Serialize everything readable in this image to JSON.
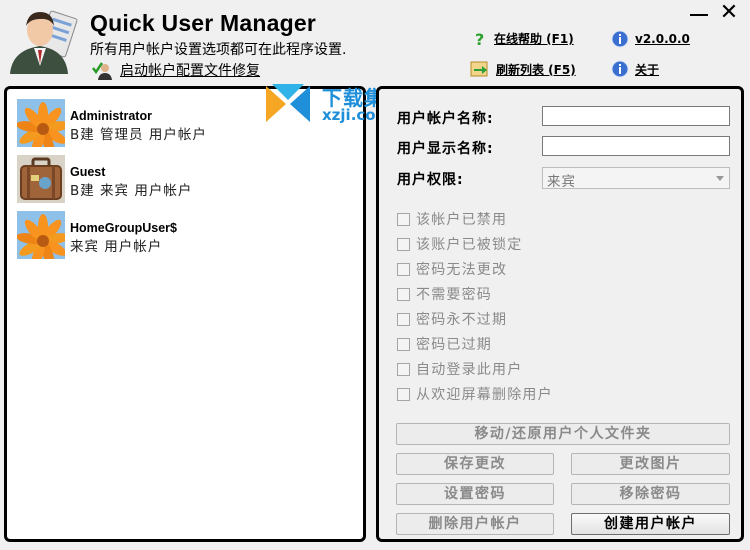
{
  "app": {
    "title": "Quick User Manager",
    "subtitle": "所有用户帐户设置选项都可在此程序设置.",
    "repair_label": "启动帐户配置文件修复"
  },
  "header_links": {
    "help": "在线帮助 (F1)",
    "version": "v2.0.0.0",
    "refresh": "刷新列表 (F5)",
    "about": "关于"
  },
  "window_controls": {
    "close": "✕"
  },
  "watermark": {
    "line1": "下载集",
    "line2": "xzji.com"
  },
  "users": [
    {
      "name": "Administrator",
      "groups": "B建 管理员 用户帐户",
      "avatar": "flower-avatar-icon"
    },
    {
      "name": "Guest",
      "groups": "B建 来宾 用户帐户",
      "avatar": "suitcase-avatar-icon"
    },
    {
      "name": "HomeGroupUser$",
      "groups": "来宾 用户帐户",
      "avatar": "flower-avatar-icon"
    }
  ],
  "form": {
    "account_name_label": "用户帐户名称:",
    "account_name_value": "",
    "display_name_label": "用户显示名称:",
    "display_name_value": "",
    "permission_label": "用户权限:",
    "permission_value": "来宾"
  },
  "options": [
    "该帐户已禁用",
    "该账户已被锁定",
    "密码无法更改",
    "不需要密码",
    "密码永不过期",
    "密码已过期",
    "自动登录此用户",
    "从欢迎屏幕删除用户"
  ],
  "buttons": {
    "move_restore": "移动/还原用户个人文件夹",
    "save": "保存更改",
    "change_picture": "更改图片",
    "set_password": "设置密码",
    "remove_password": "移除密码",
    "delete_user": "删除用户帐户",
    "create_user": "创建用户帐户"
  }
}
